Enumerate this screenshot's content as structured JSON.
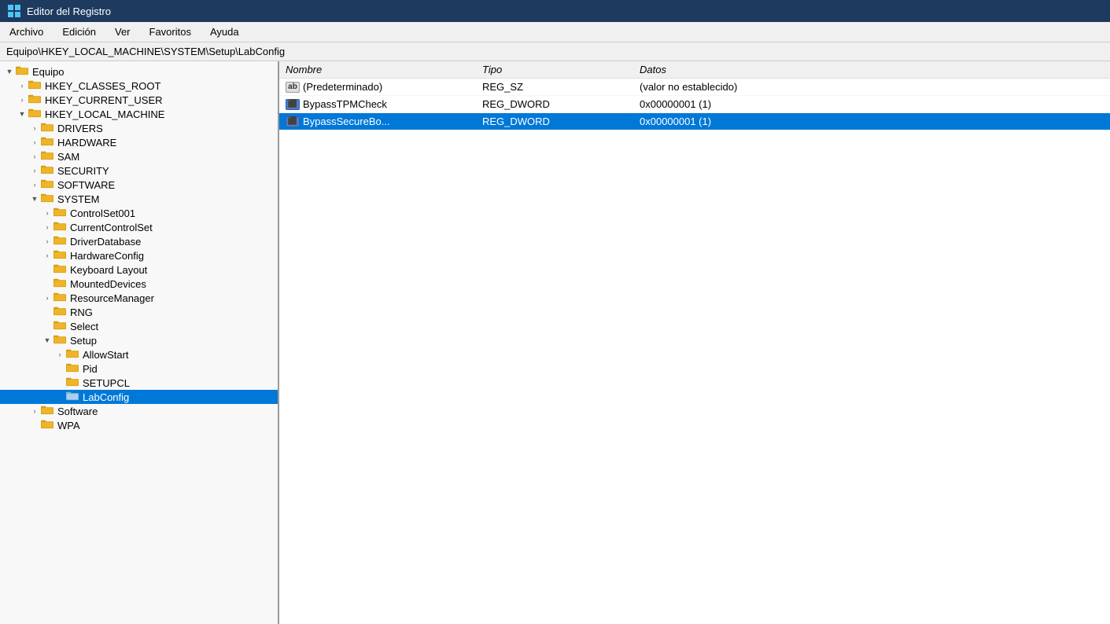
{
  "window": {
    "title": "Editor del Registro",
    "address": "Equipo\\HKEY_LOCAL_MACHINE\\SYSTEM\\Setup\\LabConfig"
  },
  "menu": {
    "items": [
      "Archivo",
      "Edición",
      "Ver",
      "Favoritos",
      "Ayuda"
    ]
  },
  "tree": {
    "items": [
      {
        "id": "equipo",
        "label": "Equipo",
        "indent": "indent-0",
        "expanded": true,
        "hasChevron": true,
        "chevronDown": true
      },
      {
        "id": "hkey_classes_root",
        "label": "HKEY_CLASSES_ROOT",
        "indent": "indent-1",
        "expanded": false,
        "hasChevron": true,
        "chevronDown": false
      },
      {
        "id": "hkey_current_user",
        "label": "HKEY_CURRENT_USER",
        "indent": "indent-1",
        "expanded": false,
        "hasChevron": true,
        "chevronDown": false
      },
      {
        "id": "hkey_local_machine",
        "label": "HKEY_LOCAL_MACHINE",
        "indent": "indent-1",
        "expanded": true,
        "hasChevron": true,
        "chevronDown": true
      },
      {
        "id": "drivers",
        "label": "DRIVERS",
        "indent": "indent-2",
        "expanded": false,
        "hasChevron": true,
        "chevronDown": false
      },
      {
        "id": "hardware",
        "label": "HARDWARE",
        "indent": "indent-2",
        "expanded": false,
        "hasChevron": true,
        "chevronDown": false
      },
      {
        "id": "sam",
        "label": "SAM",
        "indent": "indent-2",
        "expanded": false,
        "hasChevron": true,
        "chevronDown": false
      },
      {
        "id": "security",
        "label": "SECURITY",
        "indent": "indent-2",
        "expanded": false,
        "hasChevron": true,
        "chevronDown": false
      },
      {
        "id": "software",
        "label": "SOFTWARE",
        "indent": "indent-2",
        "expanded": false,
        "hasChevron": true,
        "chevronDown": false
      },
      {
        "id": "system",
        "label": "SYSTEM",
        "indent": "indent-2",
        "expanded": true,
        "hasChevron": true,
        "chevronDown": true
      },
      {
        "id": "controlset001",
        "label": "ControlSet001",
        "indent": "indent-3",
        "expanded": false,
        "hasChevron": true,
        "chevronDown": false
      },
      {
        "id": "currentcontrolset",
        "label": "CurrentControlSet",
        "indent": "indent-3",
        "expanded": false,
        "hasChevron": true,
        "chevronDown": false
      },
      {
        "id": "driverdatabase",
        "label": "DriverDatabase",
        "indent": "indent-3",
        "expanded": false,
        "hasChevron": true,
        "chevronDown": false
      },
      {
        "id": "hardwareconfig",
        "label": "HardwareConfig",
        "indent": "indent-3",
        "expanded": false,
        "hasChevron": true,
        "chevronDown": false
      },
      {
        "id": "keyboardlayout",
        "label": "Keyboard Layout",
        "indent": "indent-3",
        "expanded": false,
        "hasChevron": false,
        "chevronDown": false
      },
      {
        "id": "mounteddevices",
        "label": "MountedDevices",
        "indent": "indent-3",
        "expanded": false,
        "hasChevron": false,
        "chevronDown": false
      },
      {
        "id": "resourcemanager",
        "label": "ResourceManager",
        "indent": "indent-3",
        "expanded": false,
        "hasChevron": true,
        "chevronDown": false
      },
      {
        "id": "rng",
        "label": "RNG",
        "indent": "indent-3",
        "expanded": false,
        "hasChevron": false,
        "chevronDown": false
      },
      {
        "id": "select",
        "label": "Select",
        "indent": "indent-3",
        "expanded": false,
        "hasChevron": false,
        "chevronDown": false
      },
      {
        "id": "setup",
        "label": "Setup",
        "indent": "indent-3",
        "expanded": true,
        "hasChevron": true,
        "chevronDown": true
      },
      {
        "id": "allowstart",
        "label": "AllowStart",
        "indent": "indent-4",
        "expanded": false,
        "hasChevron": true,
        "chevronDown": false
      },
      {
        "id": "pid",
        "label": "Pid",
        "indent": "indent-4",
        "expanded": false,
        "hasChevron": false,
        "chevronDown": false
      },
      {
        "id": "setupcl",
        "label": "SETUPCL",
        "indent": "indent-4",
        "expanded": false,
        "hasChevron": false,
        "chevronDown": false
      },
      {
        "id": "labconfig",
        "label": "LabConfig",
        "indent": "indent-4",
        "expanded": false,
        "hasChevron": false,
        "chevronDown": false,
        "selected": true
      },
      {
        "id": "software2",
        "label": "Software",
        "indent": "indent-2",
        "expanded": false,
        "hasChevron": true,
        "chevronDown": false
      },
      {
        "id": "wpa",
        "label": "WPA",
        "indent": "indent-2",
        "expanded": false,
        "hasChevron": false,
        "chevronDown": false
      }
    ]
  },
  "table": {
    "columns": [
      "Nombre",
      "Tipo",
      "Datos"
    ],
    "rows": [
      {
        "name": "(Predeterminado)",
        "type": "REG_SZ",
        "data": "(valor no establecido)",
        "iconType": "ab",
        "selected": false
      },
      {
        "name": "BypassTPMCheck",
        "type": "REG_DWORD",
        "data": "0x00000001 (1)",
        "iconType": "dword",
        "selected": false
      },
      {
        "name": "BypassSecureBo...",
        "type": "REG_DWORD",
        "data": "0x00000001 (1)",
        "iconType": "dword",
        "selected": true
      }
    ]
  },
  "icons": {
    "grid": "⊞",
    "folder_color": "#d4a017",
    "folder_open_color": "#f0b429"
  }
}
